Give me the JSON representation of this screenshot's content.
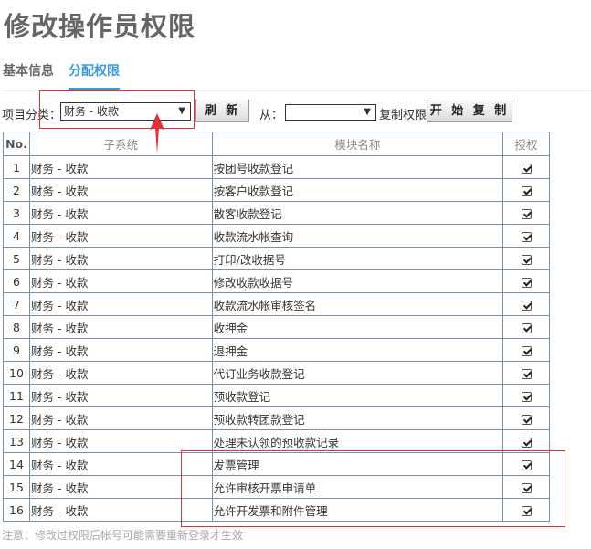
{
  "page": {
    "title": "修改操作员权限"
  },
  "tabs": [
    {
      "label": "基本信息",
      "active": false
    },
    {
      "label": "分配权限",
      "active": true
    }
  ],
  "toolbar": {
    "category_label": "项目分类：",
    "category_value": "财务 - 收款",
    "refresh_label": "刷 新",
    "from_label": "从：",
    "from_value": "",
    "copy_label": "复制权限",
    "start_copy_label": "开 始 复 制"
  },
  "table": {
    "headers": {
      "no": "No.",
      "subsystem": "子系统",
      "module": "模块名称",
      "auth": "授权"
    },
    "rows": [
      {
        "no": "1",
        "subsystem": "财务 - 收款",
        "module": "按团号收款登记",
        "checked": true
      },
      {
        "no": "2",
        "subsystem": "财务 - 收款",
        "module": "按客户收款登记",
        "checked": true
      },
      {
        "no": "3",
        "subsystem": "财务 - 收款",
        "module": "散客收款登记",
        "checked": true
      },
      {
        "no": "4",
        "subsystem": "财务 - 收款",
        "module": "收款流水帐查询",
        "checked": true
      },
      {
        "no": "5",
        "subsystem": "财务 - 收款",
        "module": "打印/改收据号",
        "checked": true
      },
      {
        "no": "6",
        "subsystem": "财务 - 收款",
        "module": "修改收款收据号",
        "checked": true
      },
      {
        "no": "7",
        "subsystem": "财务 - 收款",
        "module": "收款流水帐审核签名",
        "checked": true
      },
      {
        "no": "8",
        "subsystem": "财务 - 收款",
        "module": "收押金",
        "checked": true
      },
      {
        "no": "9",
        "subsystem": "财务 - 收款",
        "module": "退押金",
        "checked": true
      },
      {
        "no": "10",
        "subsystem": "财务 - 收款",
        "module": "代订业务收款登记",
        "checked": true
      },
      {
        "no": "11",
        "subsystem": "财务 - 收款",
        "module": "预收款登记",
        "checked": true
      },
      {
        "no": "12",
        "subsystem": "财务 - 收款",
        "module": "预收款转团款登记",
        "checked": true
      },
      {
        "no": "13",
        "subsystem": "财务 - 收款",
        "module": "处理未认领的预收款记录",
        "checked": true
      },
      {
        "no": "14",
        "subsystem": "财务 - 收款",
        "module": "发票管理",
        "checked": true
      },
      {
        "no": "15",
        "subsystem": "财务 - 收款",
        "module": "允许审核开票申请单",
        "checked": true
      },
      {
        "no": "16",
        "subsystem": "财务 - 收款",
        "module": "允许开发票和附件管理",
        "checked": true
      }
    ]
  },
  "note": "注意：修改过权限后帐号可能需要重新登录才生效",
  "colors": {
    "accent": "#3b9cd9",
    "annotation": "#e0303a",
    "grid": "#7a8fa8"
  }
}
